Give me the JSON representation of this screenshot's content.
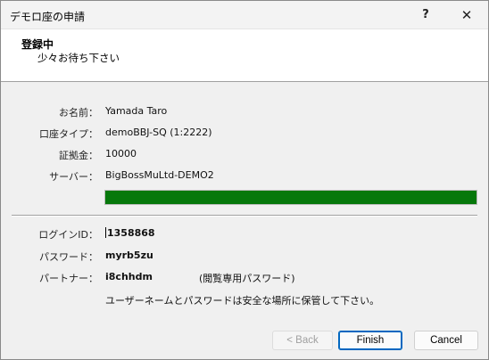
{
  "window": {
    "title": "デモロ座の申請",
    "help_label": "?",
    "close_label": "✕"
  },
  "header": {
    "title": "登録中",
    "subtitle": "少々お待ち下さい"
  },
  "account": {
    "name_label": "お名前：",
    "name_value": "Yamada Taro",
    "type_label": "口座タイプ：",
    "type_value": "demoBBJ-SQ (1:2222)",
    "deposit_label": "証拠金：",
    "deposit_value": "10000",
    "server_label": "サーバー：",
    "server_value": "BigBossMuLtd-DEMO2"
  },
  "progress": {
    "fraction": 1.0,
    "color": "#06780b"
  },
  "credentials": {
    "login_label": "ログインID：",
    "login_value": "1358868",
    "password_label": "パスワード：",
    "password_value": "myrb5zu",
    "partner_label": "パートナー：",
    "partner_value": "i8chhdm",
    "partner_note": "(閲覧専用パスワード)",
    "notice": "ユーザーネームとパスワードは安全な場所に保管して下さい。"
  },
  "buttons": {
    "back": "< Back",
    "finish": "Finish",
    "cancel": "Cancel"
  }
}
